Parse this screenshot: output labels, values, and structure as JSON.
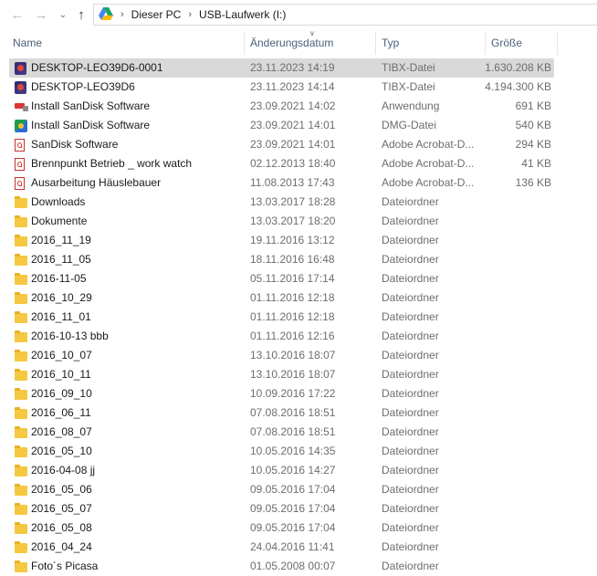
{
  "addressbar": {
    "crumbs": [
      "Dieser PC",
      "USB-Laufwerk (I:)"
    ],
    "drive_icon": "usb-drive-icon"
  },
  "columns": {
    "name": "Name",
    "date": "Änderungsdatum",
    "type": "Typ",
    "size": "Größe"
  },
  "files": [
    {
      "icon": "tibx",
      "name": "DESKTOP-LEO39D6-0001",
      "date": "23.11.2023 14:19",
      "type": "TIBX-Datei",
      "size": "1.630.208 KB",
      "selected": true
    },
    {
      "icon": "tibx",
      "name": "DESKTOP-LEO39D6",
      "date": "23.11.2023 14:14",
      "type": "TIBX-Datei",
      "size": "4.194.300 KB"
    },
    {
      "icon": "app",
      "name": "Install SanDisk Software",
      "date": "23.09.2021 14:02",
      "type": "Anwendung",
      "size": "691 KB"
    },
    {
      "icon": "dmg",
      "name": "Install SanDisk Software",
      "date": "23.09.2021 14:01",
      "type": "DMG-Datei",
      "size": "540 KB"
    },
    {
      "icon": "pdf",
      "name": "SanDisk Software",
      "date": "23.09.2021 14:01",
      "type": "Adobe Acrobat-D...",
      "size": "294 KB"
    },
    {
      "icon": "pdf",
      "name": "Brennpunkt Betrieb _ work watch",
      "date": "02.12.2013 18:40",
      "type": "Adobe Acrobat-D...",
      "size": "41 KB"
    },
    {
      "icon": "pdf",
      "name": "Ausarbeitung Häuslebauer",
      "date": "11.08.2013 17:43",
      "type": "Adobe Acrobat-D...",
      "size": "136 KB"
    },
    {
      "icon": "folder",
      "name": "Downloads",
      "date": "13.03.2017 18:28",
      "type": "Dateiordner",
      "size": ""
    },
    {
      "icon": "folder",
      "name": "Dokumente",
      "date": "13.03.2017 18:20",
      "type": "Dateiordner",
      "size": ""
    },
    {
      "icon": "folder",
      "name": "2016_11_19",
      "date": "19.11.2016 13:12",
      "type": "Dateiordner",
      "size": ""
    },
    {
      "icon": "folder",
      "name": "2016_11_05",
      "date": "18.11.2016 16:48",
      "type": "Dateiordner",
      "size": ""
    },
    {
      "icon": "folder",
      "name": "2016-11-05",
      "date": "05.11.2016 17:14",
      "type": "Dateiordner",
      "size": ""
    },
    {
      "icon": "folder",
      "name": "2016_10_29",
      "date": "01.11.2016 12:18",
      "type": "Dateiordner",
      "size": ""
    },
    {
      "icon": "folder",
      "name": "2016_11_01",
      "date": "01.11.2016 12:18",
      "type": "Dateiordner",
      "size": ""
    },
    {
      "icon": "folder",
      "name": "2016-10-13 bbb",
      "date": "01.11.2016 12:16",
      "type": "Dateiordner",
      "size": ""
    },
    {
      "icon": "folder",
      "name": "2016_10_07",
      "date": "13.10.2016 18:07",
      "type": "Dateiordner",
      "size": ""
    },
    {
      "icon": "folder",
      "name": "2016_10_11",
      "date": "13.10.2016 18:07",
      "type": "Dateiordner",
      "size": ""
    },
    {
      "icon": "folder",
      "name": "2016_09_10",
      "date": "10.09.2016 17:22",
      "type": "Dateiordner",
      "size": ""
    },
    {
      "icon": "folder",
      "name": "2016_06_11",
      "date": "07.08.2016 18:51",
      "type": "Dateiordner",
      "size": ""
    },
    {
      "icon": "folder",
      "name": "2016_08_07",
      "date": "07.08.2016 18:51",
      "type": "Dateiordner",
      "size": ""
    },
    {
      "icon": "folder",
      "name": "2016_05_10",
      "date": "10.05.2016 14:35",
      "type": "Dateiordner",
      "size": ""
    },
    {
      "icon": "folder",
      "name": "2016-04-08 jj",
      "date": "10.05.2016 14:27",
      "type": "Dateiordner",
      "size": ""
    },
    {
      "icon": "folder",
      "name": "2016_05_06",
      "date": "09.05.2016 17:04",
      "type": "Dateiordner",
      "size": ""
    },
    {
      "icon": "folder",
      "name": "2016_05_07",
      "date": "09.05.2016 17:04",
      "type": "Dateiordner",
      "size": ""
    },
    {
      "icon": "folder",
      "name": "2016_05_08",
      "date": "09.05.2016 17:04",
      "type": "Dateiordner",
      "size": ""
    },
    {
      "icon": "folder",
      "name": "2016_04_24",
      "date": "24.04.2016 11:41",
      "type": "Dateiordner",
      "size": ""
    },
    {
      "icon": "folder",
      "name": "Foto´s Picasa",
      "date": "01.05.2008 00:07",
      "type": "Dateiordner",
      "size": ""
    }
  ]
}
